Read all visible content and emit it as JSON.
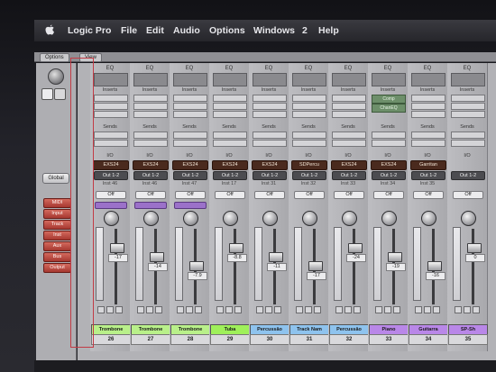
{
  "menubar": {
    "app_name": "Logic Pro",
    "items": [
      "File",
      "Edit",
      "Audio",
      "Options",
      "Windows",
      "2",
      "Help"
    ]
  },
  "window": {
    "options_label": "Options",
    "view_label": "View"
  },
  "left_panel": {
    "global_label": "Global",
    "filters": [
      "MIDI",
      "Input",
      "Track",
      "Inst",
      "Aux",
      "Bus",
      "Output"
    ]
  },
  "labels": {
    "eq": "EQ",
    "inserts": "Inserts",
    "sends": "Sends",
    "io": "I/O",
    "off": "Off",
    "out": "Out 1-2"
  },
  "right_insert_plugins": [
    "Comp",
    "ChanEQ"
  ],
  "strips": [
    {
      "instrument": "EXS24",
      "io_detail": "Inst 46",
      "db": "-17",
      "name": "Trombone",
      "number": "26",
      "name_color": "#b9f08a"
    },
    {
      "instrument": "EXS24",
      "io_detail": "Inst 46",
      "db": "-14",
      "name": "Trombone",
      "number": "27",
      "name_color": "#b9f08a"
    },
    {
      "instrument": "EXS24",
      "io_detail": "Inst 47",
      "db": "-7.9",
      "name": "Trombone",
      "number": "28",
      "name_color": "#b9f08a"
    },
    {
      "instrument": "EXS24",
      "io_detail": "Inst 17",
      "db": "-8.8",
      "name": "Tuba",
      "number": "29",
      "name_color": "#9ff05a"
    },
    {
      "instrument": "EXS24",
      "io_detail": "Inst 31",
      "db": "-11",
      "name": "Percussão",
      "number": "30",
      "name_color": "#8ec3ee"
    },
    {
      "instrument": "SDPercu",
      "io_detail": "Inst 32",
      "db": "-17",
      "name": "Track Nam",
      "number": "31",
      "name_color": "#8ec3ee"
    },
    {
      "instrument": "EXS24",
      "io_detail": "Inst 33",
      "db": "-24",
      "name": "Percussão",
      "number": "32",
      "name_color": "#8ec3ee"
    },
    {
      "instrument": "EXS24",
      "io_detail": "Inst 34",
      "db": "-19",
      "name": "Piano",
      "number": "33",
      "name_color": "#b987e8"
    },
    {
      "instrument": "Garritan",
      "io_detail": "Inst 35",
      "db": "-16",
      "name": "Guitarra",
      "number": "34",
      "name_color": "#b987e8"
    },
    {
      "instrument": "",
      "io_detail": "",
      "db": "0",
      "name": "SP-Sh",
      "number": "35",
      "name_color": "#b987e8"
    }
  ],
  "colors": {
    "accent_red": "#c23b45",
    "mixer_bg": "#b2b2b6"
  }
}
